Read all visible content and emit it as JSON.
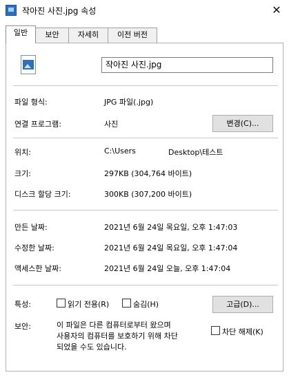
{
  "window": {
    "title": "작아진 사진.jpg 속성",
    "close_glyph": "✕"
  },
  "tabs": [
    {
      "label": "일반"
    },
    {
      "label": "보안"
    },
    {
      "label": "자세히"
    },
    {
      "label": "이전 버전"
    }
  ],
  "general": {
    "filename": "작아진 사진.jpg",
    "file_type_label": "파일 형식:",
    "file_type_value": "JPG 파일(.jpg)",
    "opens_with_label": "연결 프로그램:",
    "opens_with_value": "사진",
    "change_button": "변경(C)...",
    "location_label": "위치:",
    "location_prefix": "C:\\Users",
    "location_suffix": "Desktop\\테스트",
    "size_label": "크기:",
    "size_value": "297KB (304,764 바이트)",
    "size_on_disk_label": "디스크 할당 크기:",
    "size_on_disk_value": "300KB (307,200 바이트)",
    "created_label": "만든 날짜:",
    "created_value": "2021년 6월 24일 목요일, 오후 1:47:03",
    "modified_label": "수정한 날짜:",
    "modified_value": "2021년 6월 24일 목요일, 오후 1:47:04",
    "accessed_label": "액세스한 날짜:",
    "accessed_value": "2021년 6월 24일 오늘, 오후 1:47:04",
    "attributes_label": "특성:",
    "readonly_label": "읽기 전용(R)",
    "hidden_label": "숨김(H)",
    "advanced_button": "고급(D)...",
    "security_label": "보안:",
    "security_line1": "이 파일은 다른 컴퓨터로부터 왔으며",
    "security_line2": "사용자의 컴퓨터를 보호하기 위해 차단",
    "security_line3": "되었을 수도 있습니다.",
    "unblock_label": "차단 해제(K)"
  }
}
